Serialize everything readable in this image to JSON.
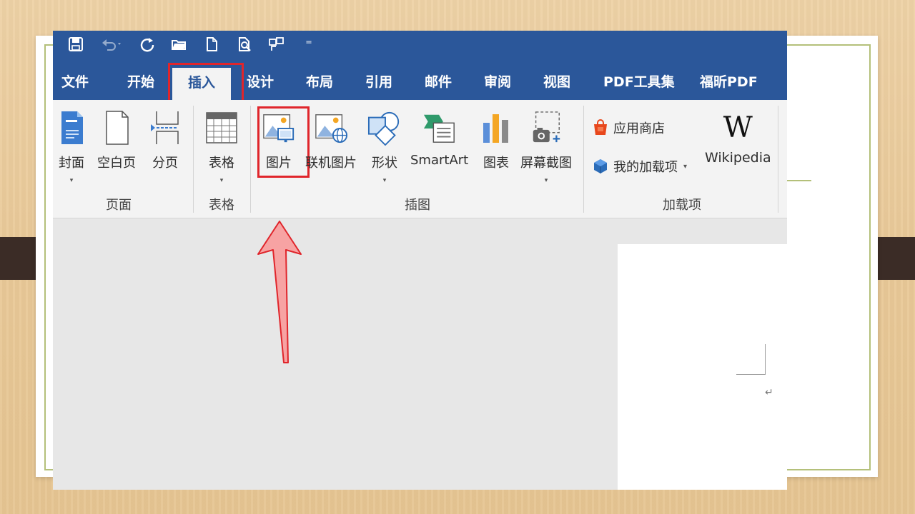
{
  "quick_access": {
    "icons": [
      "save-icon",
      "undo-icon",
      "redo-icon",
      "open-folder-icon",
      "new-document-icon",
      "print-preview-icon",
      "touch-mode-icon",
      "customize-dropdown-icon"
    ],
    "customize_glyph": "⁼"
  },
  "tabs": [
    {
      "label": "文件"
    },
    {
      "label": "开始"
    },
    {
      "label": "插入",
      "active": true
    },
    {
      "label": "设计"
    },
    {
      "label": "布局"
    },
    {
      "label": "引用"
    },
    {
      "label": "邮件"
    },
    {
      "label": "审阅"
    },
    {
      "label": "视图"
    },
    {
      "label": "PDF工具集"
    },
    {
      "label": "福昕PDF"
    }
  ],
  "ribbon": {
    "pages": {
      "group_label": "页面",
      "buttons": [
        {
          "label": "封面",
          "icon": "cover-page-icon",
          "has_dropdown": true
        },
        {
          "label": "空白页",
          "icon": "blank-page-icon"
        },
        {
          "label": "分页",
          "icon": "page-break-icon"
        }
      ]
    },
    "tables": {
      "group_label": "表格",
      "buttons": [
        {
          "label": "表格",
          "icon": "table-icon",
          "has_dropdown": true
        }
      ]
    },
    "illustrations": {
      "group_label": "插图",
      "buttons": [
        {
          "label": "图片",
          "icon": "picture-icon",
          "highlighted": true
        },
        {
          "label": "联机图片",
          "icon": "online-picture-icon"
        },
        {
          "label": "形状",
          "icon": "shapes-icon",
          "has_dropdown": true
        },
        {
          "label": "SmartArt",
          "icon": "smartart-icon"
        },
        {
          "label": "图表",
          "icon": "chart-icon"
        },
        {
          "label": "屏幕截图",
          "icon": "screenshot-icon",
          "has_dropdown": true
        }
      ]
    },
    "addins": {
      "group_label": "加载项",
      "store_label": "应用商店",
      "my_addins_label": "我的加载项",
      "wikipedia_label": "Wikipedia",
      "wikipedia_logo": "W"
    },
    "dropdown_glyph": "▾"
  },
  "document": {
    "paragraph_mark": "↵"
  },
  "colors": {
    "title_bar": "#2b579a",
    "ribbon_bg": "#f3f3f3",
    "highlight": "#e0252b",
    "arrow_fill": "#f7a3a3",
    "arrow_stroke": "#e0252b"
  }
}
